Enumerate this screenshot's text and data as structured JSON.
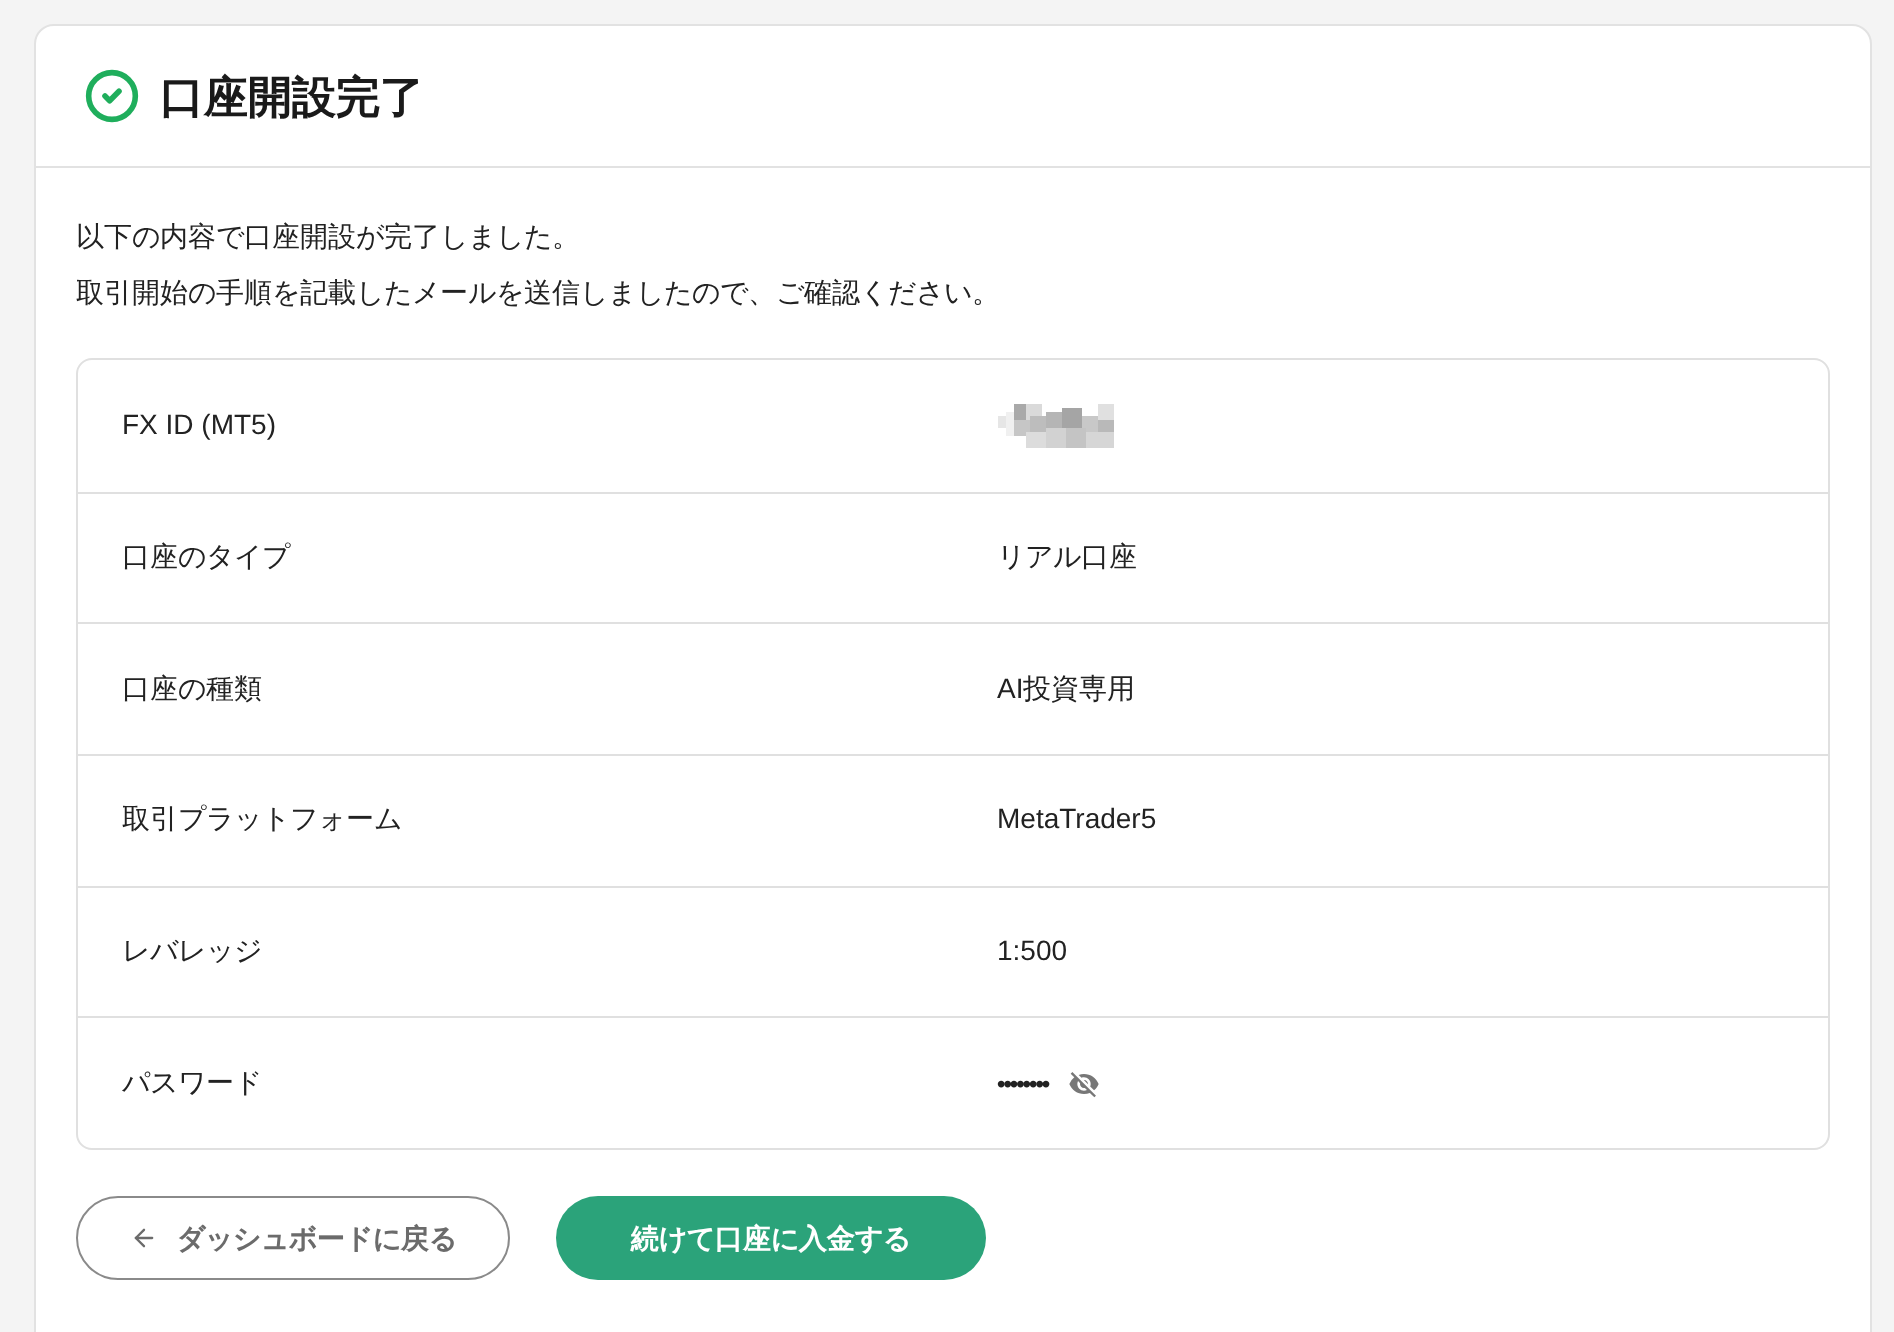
{
  "header": {
    "title": "口座開設完了"
  },
  "message": [
    "以下の内容で口座開設が完了しました。",
    "取引開始の手順を記載したメールを送信しましたので、ご確認ください。"
  ],
  "details": [
    {
      "kind": "redacted",
      "label": "FX ID (MT5)"
    },
    {
      "kind": "text",
      "label": "口座のタイプ",
      "value": "リアル口座"
    },
    {
      "kind": "text",
      "label": "口座の種類",
      "value": "AI投資専用"
    },
    {
      "kind": "text",
      "label": "取引プラットフォーム",
      "value": "MetaTrader5"
    },
    {
      "kind": "text",
      "label": "レバレッジ",
      "value": "1:500"
    },
    {
      "kind": "password",
      "label": "パスワード",
      "value": "••••••••"
    }
  ],
  "buttons": [
    {
      "kind": "back",
      "label": "ダッシュボードに戻る"
    },
    {
      "kind": "primary",
      "label": "続けて口座に入金する"
    }
  ]
}
